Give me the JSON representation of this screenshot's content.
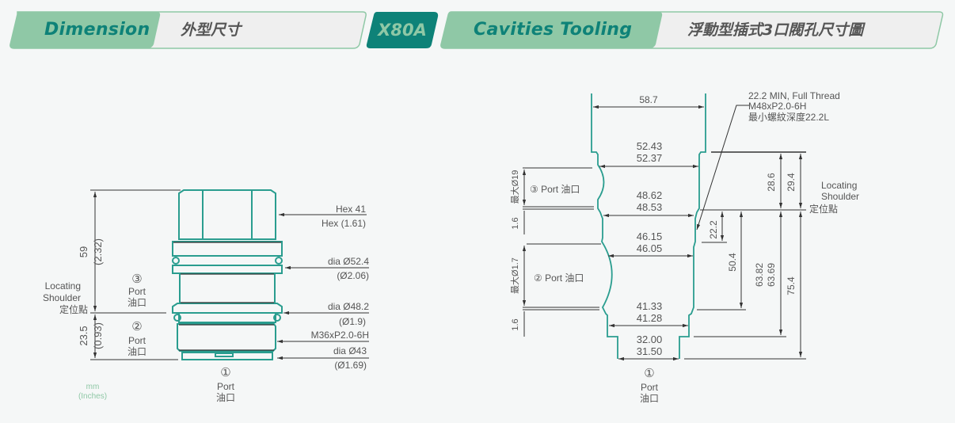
{
  "header": {
    "dimension": {
      "en": "Dimension",
      "zh": "外型尺寸"
    },
    "model": "X80A",
    "cavity": {
      "en": "Cavities Tooling",
      "zh": "浮動型插式3口閥孔尺寸圖"
    }
  },
  "colors": {
    "teal": "#0e8278",
    "mint": "#8fc8a6",
    "outline": "#2a9d8f",
    "dim_line": "#333333",
    "text": "#555555"
  },
  "left_view": {
    "overall_height": "59",
    "overall_height_in": "(2.32)",
    "lower_height": "23.5",
    "lower_height_in": "(0.93)",
    "locating_shoulder": [
      "Locating",
      "Shoulder",
      "定位點"
    ],
    "port3": {
      "num": "③",
      "en": "Port",
      "zh": "油口"
    },
    "port2": {
      "num": "②",
      "en": "Port",
      "zh": "油口"
    },
    "port1": {
      "num": "①",
      "en": "Port",
      "zh": "油口"
    },
    "callouts": [
      {
        "line1": "Hex  41",
        "line2": "Hex  (1.61)"
      },
      {
        "line1": "dia  Ø52.4",
        "line2": "(Ø2.06)"
      },
      {
        "line1": "dia  Ø48.2",
        "line2": "(Ø1.9)"
      },
      {
        "line1": "M36xP2.0-6H",
        "line2": ""
      },
      {
        "line1": "dia  Ø43",
        "line2": "(Ø1.69)"
      }
    ],
    "units": {
      "mm": "mm",
      "inches": "(Inches)"
    }
  },
  "right_view": {
    "top_width": "58.7",
    "thread_note": [
      "22.2 MIN, Full Thread",
      "M48xP2.0-6H",
      "最小螺紋深度22.2L"
    ],
    "bores": [
      {
        "max": "52.43",
        "min": "52.37"
      },
      {
        "max": "48.62",
        "min": "48.53"
      },
      {
        "max": "46.15",
        "min": "46.05"
      },
      {
        "max": "41.33",
        "min": "41.28"
      },
      {
        "max": "32.00",
        "min": "31.50"
      }
    ],
    "port3_width": "最大Ø19",
    "port2_width": "最大Ø1.7",
    "gap1": "1.6",
    "gap2": "1.6",
    "port3_label": "③ Port 油口",
    "port2_label": "② Port 油口",
    "port1": {
      "num": "①",
      "en": "Port",
      "zh": "油口"
    },
    "depths": {
      "d28_6": "28.6",
      "d29_4": "29.4",
      "d22_2": "22.2",
      "d50_4": "50.4",
      "d63_max": "63.82",
      "d63_min": "63.69",
      "d75_4": "75.4"
    },
    "locating_shoulder": [
      "Locating",
      "Shoulder",
      "定位點"
    ]
  }
}
